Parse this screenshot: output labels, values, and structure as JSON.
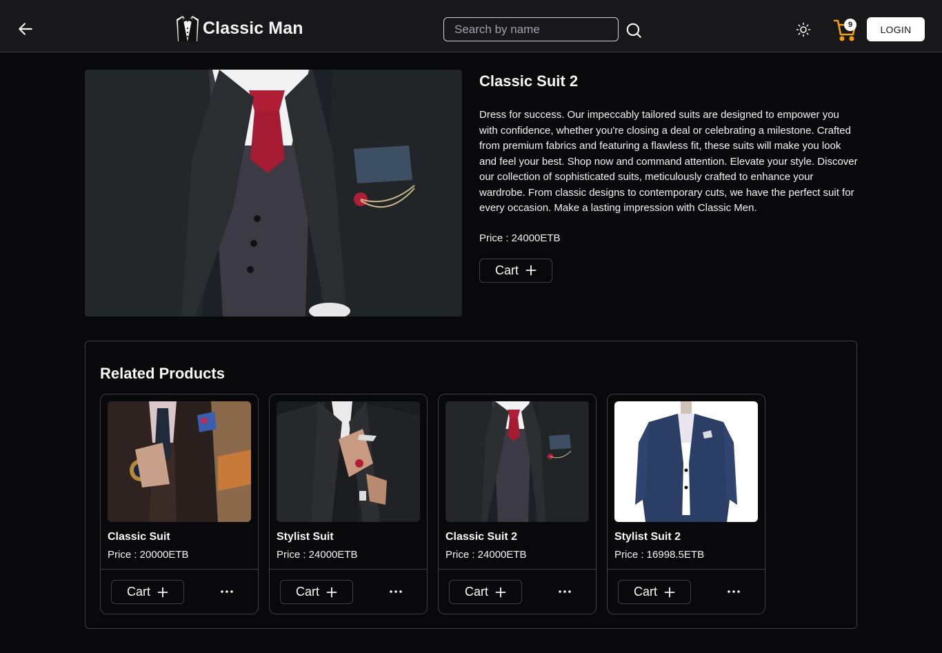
{
  "header": {
    "brand": "Classic Man",
    "search_placeholder": "Search by name",
    "cart_count": "9",
    "login_label": "LOGIN"
  },
  "product": {
    "title": "Classic Suit 2",
    "description": "Dress for success. Our impeccably tailored suits are designed to empower you with confidence, whether you're closing a deal or celebrating a milestone. Crafted from premium fabrics and featuring a flawless fit, these suits will make you look and feel your best. Shop now and command attention. Elevate your style. Discover our collection of sophisticated suits, meticulously crafted to enhance your wardrobe. From classic designs to contemporary cuts, we have the perfect suit for every occasion. Make a lasting impression with Classic Men.",
    "price": "Price : 24000ETB",
    "cart_label": "Cart"
  },
  "related": {
    "title": "Related Products",
    "items": [
      {
        "name": "Classic Suit",
        "price": "Price : 20000ETB",
        "cart_label": "Cart"
      },
      {
        "name": "Stylist Suit",
        "price": "Price : 24000ETB",
        "cart_label": "Cart"
      },
      {
        "name": "Classic Suit 2",
        "price": "Price : 24000ETB",
        "cart_label": "Cart"
      },
      {
        "name": "Stylist Suit 2",
        "price": "Price : 16998.5ETB",
        "cart_label": "Cart"
      }
    ]
  },
  "icons": {
    "back": "arrow-left-icon",
    "logo": "tuxedo-icon",
    "search": "search-icon",
    "theme": "sun-icon",
    "cart": "shopping-cart-icon",
    "plus": "plus-icon",
    "more": "ellipsis-icon"
  },
  "colors": {
    "background": "#09090b",
    "navbar": "#18181b",
    "border": "#3f3f46",
    "cart_icon": "#f59e0b",
    "text": "#fafafa"
  }
}
